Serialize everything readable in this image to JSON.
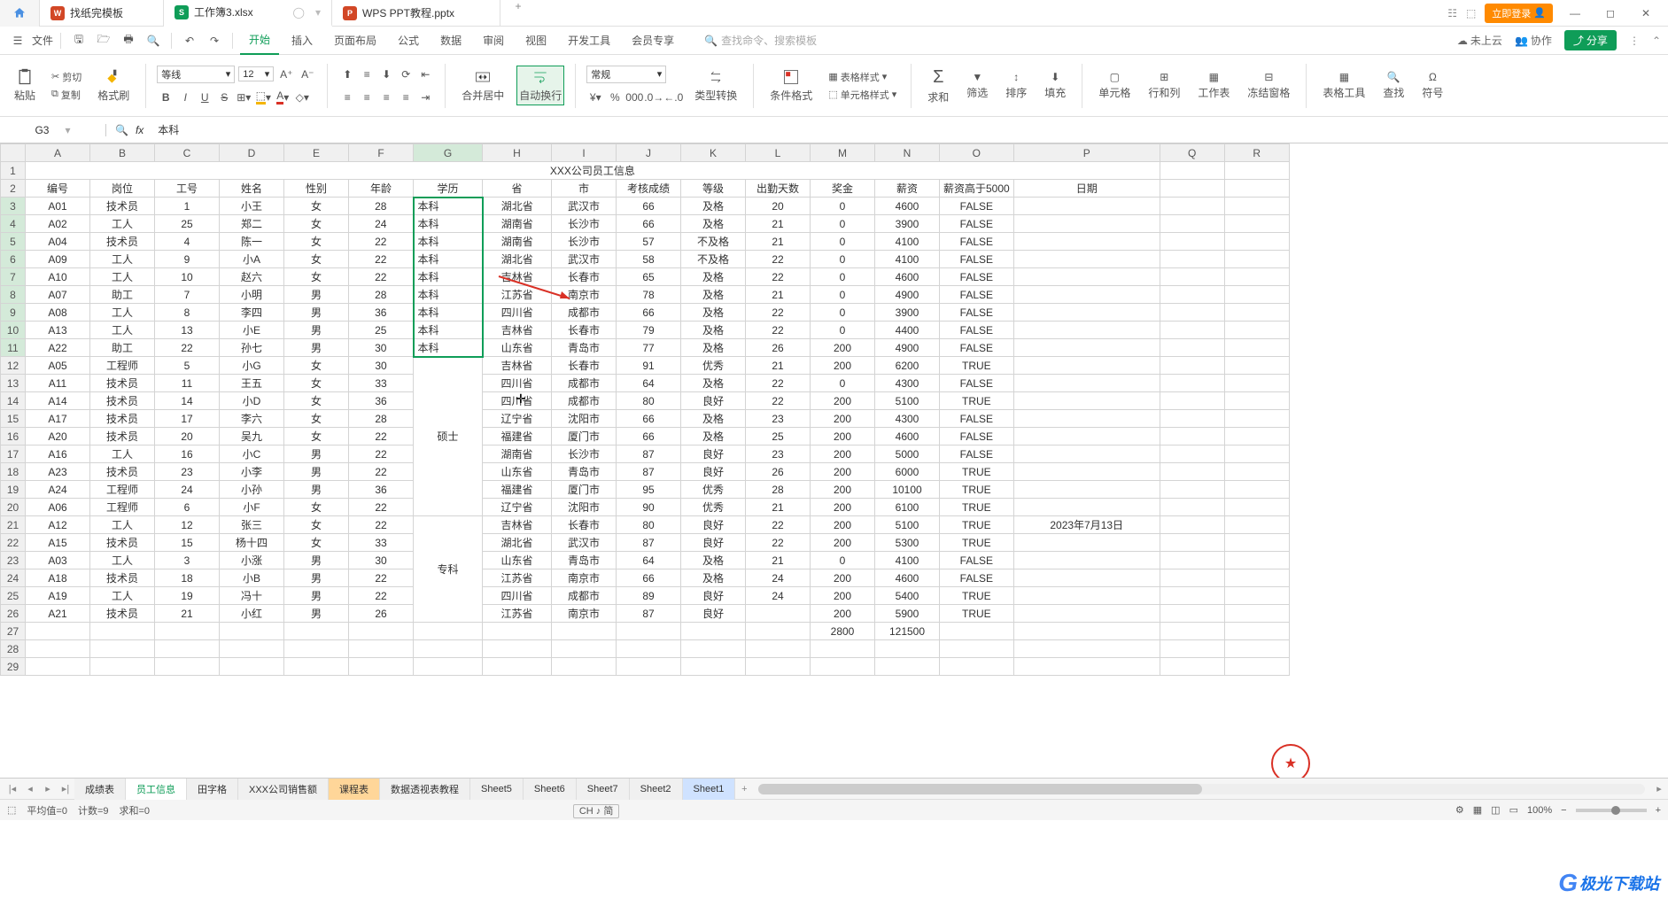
{
  "titlebar": {
    "home": "首页",
    "tabs": [
      {
        "icon": "W",
        "label": "找纸完模板"
      },
      {
        "icon": "S",
        "label": "工作簿3.xlsx",
        "active": true
      },
      {
        "icon": "P",
        "label": "WPS PPT教程.pptx"
      }
    ],
    "login": "立即登录"
  },
  "menubar": {
    "file": "文件",
    "tabs": [
      "开始",
      "插入",
      "页面布局",
      "公式",
      "数据",
      "审阅",
      "视图",
      "开发工具",
      "会员专享"
    ],
    "search_placeholder": "查找命令、搜索模板",
    "cloud": "未上云",
    "collab": "协作",
    "share": "分享"
  },
  "ribbon": {
    "paste": "粘贴",
    "cut": "剪切",
    "copy": "复制",
    "format_painter": "格式刷",
    "font": "等线",
    "font_size": "12",
    "merge": "合并居中",
    "autowrap": "自动换行",
    "number_format": "常规",
    "type_convert": "类型转换",
    "cond_fmt": "条件格式",
    "table_style": "表格样式",
    "cell_style": "单元格样式",
    "sum": "求和",
    "filter": "筛选",
    "sort": "排序",
    "fill": "填充",
    "cell": "单元格",
    "rowcol": "行和列",
    "worksheet": "工作表",
    "freeze": "冻结窗格",
    "table_tools": "表格工具",
    "find": "查找",
    "symbol": "符号"
  },
  "formula": {
    "cell_ref": "G3",
    "fx": "fx",
    "content": "本科"
  },
  "columns": [
    "A",
    "B",
    "C",
    "D",
    "E",
    "F",
    "G",
    "H",
    "I",
    "J",
    "K",
    "L",
    "M",
    "N",
    "O",
    "P",
    "Q",
    "R"
  ],
  "title_row": "XXX公司员工信息",
  "headers": [
    "编号",
    "岗位",
    "工号",
    "姓名",
    "性别",
    "年龄",
    "学历",
    "省",
    "市",
    "考核成绩",
    "等级",
    "出勤天数",
    "奖金",
    "薪资",
    "薪资高于5000",
    "日期"
  ],
  "merge_education": {
    "shuoshi": "硕士",
    "zhuanke": "专科"
  },
  "date_cell": "2023年7月13日",
  "totals": {
    "bonus": "2800",
    "salary": "121500"
  },
  "rows": [
    [
      "A01",
      "技术员",
      "1",
      "小王",
      "女",
      "28",
      "本科",
      "湖北省",
      "武汉市",
      "66",
      "及格",
      "20",
      "0",
      "4600",
      "FALSE",
      ""
    ],
    [
      "A02",
      "工人",
      "25",
      "郑二",
      "女",
      "24",
      "本科",
      "湖南省",
      "长沙市",
      "66",
      "及格",
      "21",
      "0",
      "3900",
      "FALSE",
      ""
    ],
    [
      "A04",
      "技术员",
      "4",
      "陈一",
      "女",
      "22",
      "本科",
      "湖南省",
      "长沙市",
      "57",
      "不及格",
      "21",
      "0",
      "4100",
      "FALSE",
      ""
    ],
    [
      "A09",
      "工人",
      "9",
      "小A",
      "女",
      "22",
      "本科",
      "湖北省",
      "武汉市",
      "58",
      "不及格",
      "22",
      "0",
      "4100",
      "FALSE",
      ""
    ],
    [
      "A10",
      "工人",
      "10",
      "赵六",
      "女",
      "22",
      "本科",
      "吉林省",
      "长春市",
      "65",
      "及格",
      "22",
      "0",
      "4600",
      "FALSE",
      ""
    ],
    [
      "A07",
      "助工",
      "7",
      "小明",
      "男",
      "28",
      "本科",
      "江苏省",
      "南京市",
      "78",
      "及格",
      "21",
      "0",
      "4900",
      "FALSE",
      ""
    ],
    [
      "A08",
      "工人",
      "8",
      "李四",
      "男",
      "36",
      "本科",
      "四川省",
      "成都市",
      "66",
      "及格",
      "22",
      "0",
      "3900",
      "FALSE",
      ""
    ],
    [
      "A13",
      "工人",
      "13",
      "小E",
      "男",
      "25",
      "本科",
      "吉林省",
      "长春市",
      "79",
      "及格",
      "22",
      "0",
      "4400",
      "FALSE",
      ""
    ],
    [
      "A22",
      "助工",
      "22",
      "孙七",
      "男",
      "30",
      "本科",
      "山东省",
      "青岛市",
      "77",
      "及格",
      "26",
      "200",
      "4900",
      "FALSE",
      ""
    ],
    [
      "A05",
      "工程师",
      "5",
      "小G",
      "女",
      "30",
      "",
      "吉林省",
      "长春市",
      "91",
      "优秀",
      "21",
      "200",
      "6200",
      "TRUE",
      ""
    ],
    [
      "A11",
      "技术员",
      "11",
      "王五",
      "女",
      "33",
      "",
      "四川省",
      "成都市",
      "64",
      "及格",
      "22",
      "0",
      "4300",
      "FALSE",
      ""
    ],
    [
      "A14",
      "技术员",
      "14",
      "小D",
      "女",
      "36",
      "",
      "四川省",
      "成都市",
      "80",
      "良好",
      "22",
      "200",
      "5100",
      "TRUE",
      ""
    ],
    [
      "A17",
      "技术员",
      "17",
      "李六",
      "女",
      "28",
      "",
      "辽宁省",
      "沈阳市",
      "66",
      "及格",
      "23",
      "200",
      "4300",
      "FALSE",
      ""
    ],
    [
      "A20",
      "技术员",
      "20",
      "吴九",
      "女",
      "22",
      "",
      "福建省",
      "厦门市",
      "66",
      "及格",
      "25",
      "200",
      "4600",
      "FALSE",
      ""
    ],
    [
      "A16",
      "工人",
      "16",
      "小C",
      "男",
      "22",
      "",
      "湖南省",
      "长沙市",
      "87",
      "良好",
      "23",
      "200",
      "5000",
      "FALSE",
      ""
    ],
    [
      "A23",
      "技术员",
      "23",
      "小李",
      "男",
      "22",
      "",
      "山东省",
      "青岛市",
      "87",
      "良好",
      "26",
      "200",
      "6000",
      "TRUE",
      ""
    ],
    [
      "A24",
      "工程师",
      "24",
      "小孙",
      "男",
      "36",
      "",
      "福建省",
      "厦门市",
      "95",
      "优秀",
      "28",
      "200",
      "10100",
      "TRUE",
      ""
    ],
    [
      "A06",
      "工程师",
      "6",
      "小F",
      "女",
      "22",
      "",
      "辽宁省",
      "沈阳市",
      "90",
      "优秀",
      "21",
      "200",
      "6100",
      "TRUE",
      ""
    ],
    [
      "A12",
      "工人",
      "12",
      "张三",
      "女",
      "22",
      "",
      "吉林省",
      "长春市",
      "80",
      "良好",
      "22",
      "200",
      "5100",
      "TRUE",
      "2023年7月13日"
    ],
    [
      "A15",
      "技术员",
      "15",
      "杨十四",
      "女",
      "33",
      "",
      "湖北省",
      "武汉市",
      "87",
      "良好",
      "22",
      "200",
      "5300",
      "TRUE",
      ""
    ],
    [
      "A03",
      "工人",
      "3",
      "小涨",
      "男",
      "30",
      "",
      "山东省",
      "青岛市",
      "64",
      "及格",
      "21",
      "0",
      "4100",
      "FALSE",
      ""
    ],
    [
      "A18",
      "技术员",
      "18",
      "小B",
      "男",
      "22",
      "",
      "江苏省",
      "南京市",
      "66",
      "及格",
      "24",
      "200",
      "4600",
      "FALSE",
      ""
    ],
    [
      "A19",
      "工人",
      "19",
      "冯十",
      "男",
      "22",
      "",
      "四川省",
      "成都市",
      "89",
      "良好",
      "24",
      "200",
      "5400",
      "TRUE",
      ""
    ],
    [
      "A21",
      "技术员",
      "21",
      "小红",
      "男",
      "26",
      "",
      "江苏省",
      "南京市",
      "87",
      "良好",
      "",
      "200",
      "5900",
      "TRUE",
      ""
    ]
  ],
  "sheet_tabs": [
    "成绩表",
    "员工信息",
    "田字格",
    "XXX公司销售额",
    "课程表",
    "数据透视表教程",
    "Sheet5",
    "Sheet6",
    "Sheet7",
    "Sheet2",
    "Sheet1"
  ],
  "statusbar": {
    "avg": "平均值=0",
    "count": "计数=9",
    "sum": "求和=0",
    "ime": "CH ♪ 简",
    "zoom": "100%"
  },
  "watermark": "极光下载站"
}
